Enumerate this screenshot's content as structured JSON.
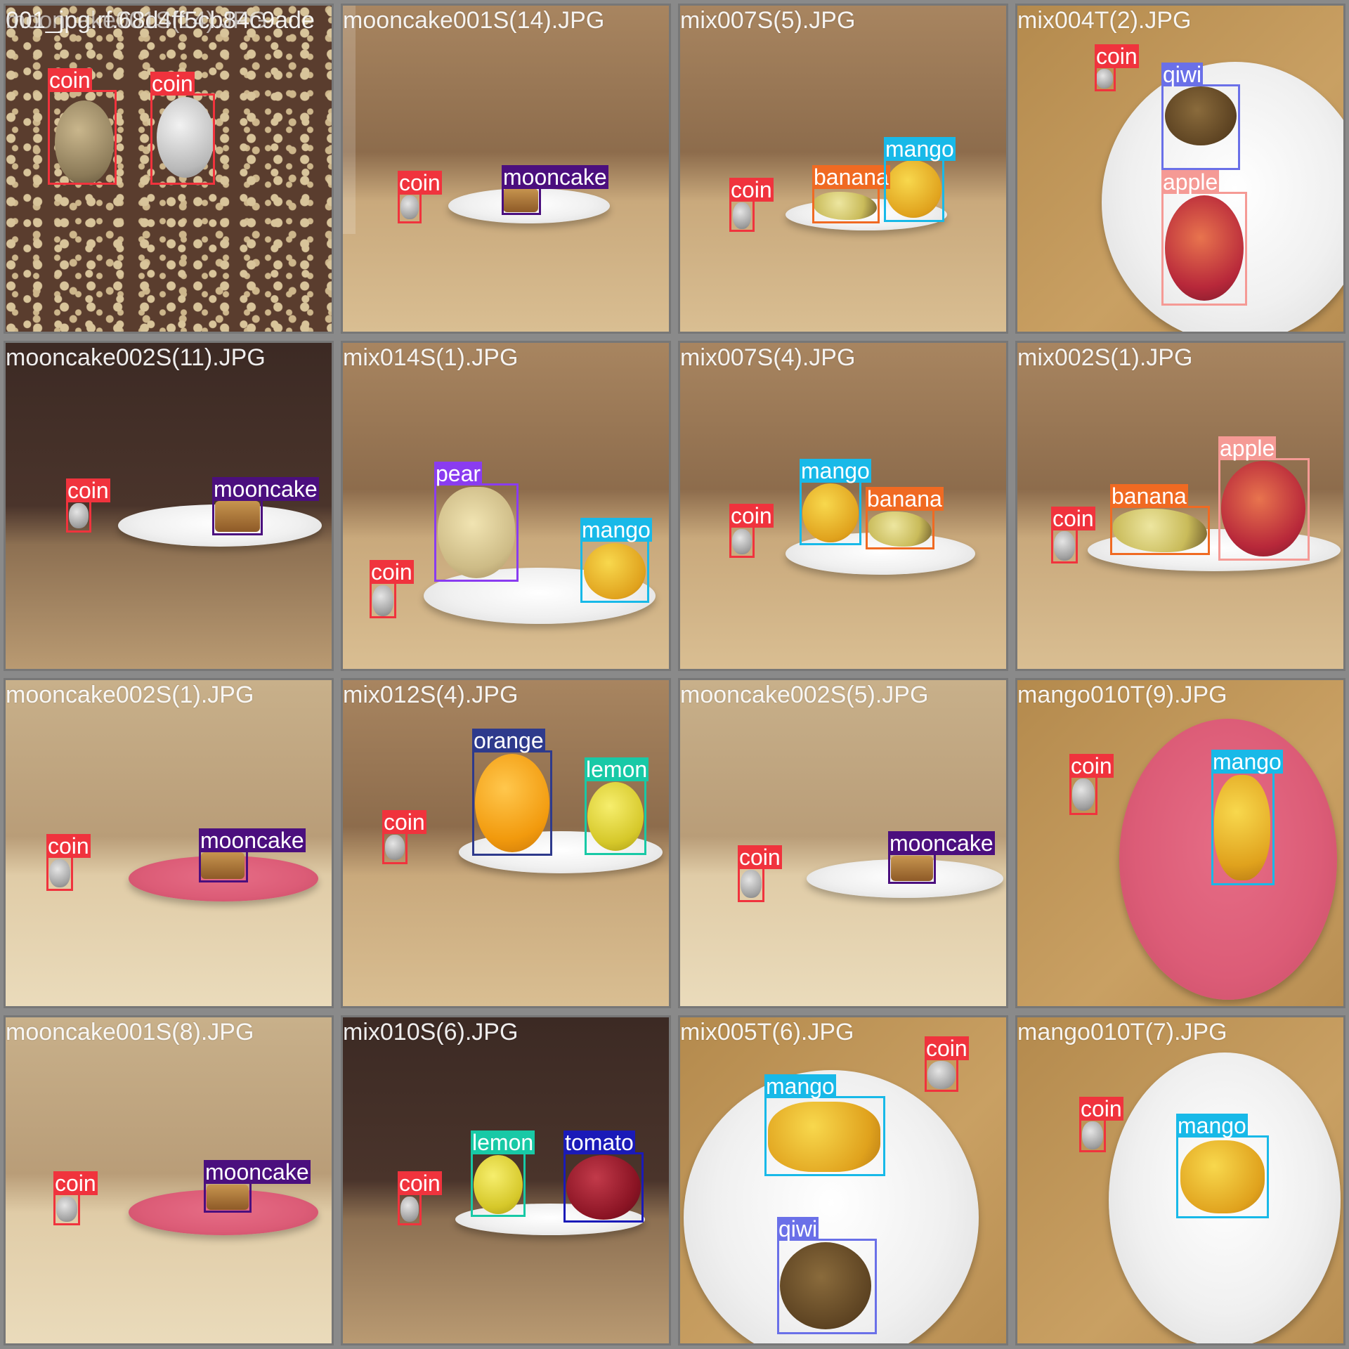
{
  "tiles": [
    {
      "title": "001_jpg.rf.68d4ff5cb84c9ade",
      "overlap_title": "mooncake001S(14).JPG",
      "background": "carpet",
      "detections": [
        "coin",
        "coin"
      ]
    },
    {
      "title": "mooncake001S(14).JPG",
      "background": "cabinet",
      "detections": [
        "coin",
        "mooncake"
      ]
    },
    {
      "title": "mix007S(5).JPG",
      "background": "cabinet",
      "detections": [
        "coin",
        "banana",
        "mango"
      ]
    },
    {
      "title": "mix004T(2).JPG",
      "background": "table",
      "detections": [
        "coin",
        "qiwi",
        "apple"
      ]
    },
    {
      "title": "mooncake002S(11).JPG",
      "background": "cabinet-dark",
      "detections": [
        "coin",
        "mooncake"
      ]
    },
    {
      "title": "mix014S(1).JPG",
      "background": "cabinet",
      "detections": [
        "pear",
        "mango",
        "coin"
      ]
    },
    {
      "title": "mix007S(4).JPG",
      "background": "cabinet",
      "detections": [
        "mango",
        "banana",
        "coin"
      ]
    },
    {
      "title": "mix002S(1).JPG",
      "background": "cabinet",
      "detections": [
        "apple",
        "banana",
        "coin"
      ]
    },
    {
      "title": "mooncake002S(1).JPG",
      "background": "cabinet-light",
      "detections": [
        "coin",
        "mooncake"
      ]
    },
    {
      "title": "mix012S(4).JPG",
      "background": "cabinet",
      "detections": [
        "orange",
        "lemon",
        "coin"
      ]
    },
    {
      "title": "mooncake002S(5).JPG",
      "background": "cabinet-light",
      "detections": [
        "coin",
        "mooncake"
      ]
    },
    {
      "title": "mango010T(9).JPG",
      "background": "table",
      "detections": [
        "coin",
        "mango"
      ]
    },
    {
      "title": "mooncake001S(8).JPG",
      "background": "cabinet-light",
      "detections": [
        "coin",
        "mooncake"
      ]
    },
    {
      "title": "mix010S(6).JPG",
      "background": "cabinet-dark",
      "detections": [
        "lemon",
        "tomato",
        "coin"
      ]
    },
    {
      "title": "mix005T(6).JPG",
      "background": "table",
      "detections": [
        "coin",
        "mango",
        "qiwi"
      ]
    },
    {
      "title": "mango010T(7).JPG",
      "background": "table",
      "detections": [
        "coin",
        "mango"
      ]
    }
  ],
  "class_colors": {
    "coin": "#f0333d",
    "mooncake": "#4b0f7e",
    "mango": "#18b9e8",
    "banana": "#f06a22",
    "qiwi": "#6a70e8",
    "apple": "#f59a95",
    "pear": "#8a3cf0",
    "orange": "#2e3a8c",
    "lemon": "#18c9a6",
    "tomato": "#1a1ab8"
  }
}
